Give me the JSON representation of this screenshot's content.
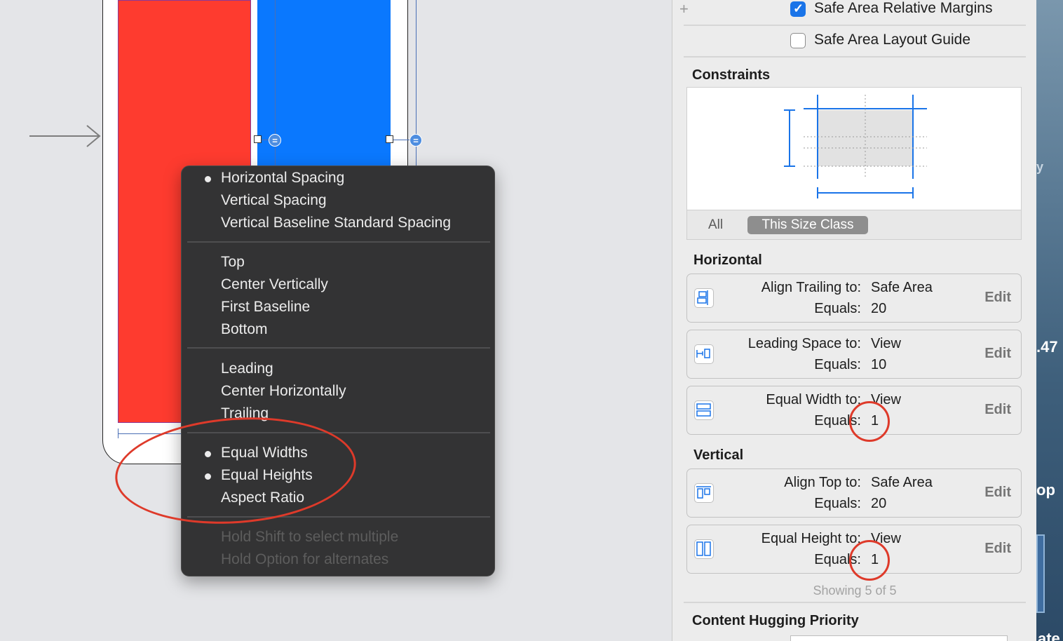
{
  "menu": {
    "items": [
      {
        "label": "Horizontal Spacing",
        "checked": true
      },
      {
        "label": "Vertical Spacing",
        "checked": false
      },
      {
        "label": "Vertical Baseline Standard Spacing",
        "checked": false
      },
      {
        "label": "Top",
        "checked": false
      },
      {
        "label": "Center Vertically",
        "checked": false
      },
      {
        "label": "First Baseline",
        "checked": false
      },
      {
        "label": "Bottom",
        "checked": false
      },
      {
        "label": "Leading",
        "checked": false
      },
      {
        "label": "Center Horizontally",
        "checked": false
      },
      {
        "label": "Trailing",
        "checked": false
      },
      {
        "label": "Equal Widths",
        "checked": true
      },
      {
        "label": "Equal Heights",
        "checked": true
      },
      {
        "label": "Aspect Ratio",
        "checked": false
      }
    ],
    "hints": [
      "Hold Shift to select multiple",
      "Hold Option for alternates"
    ]
  },
  "canvas": {
    "eq_symbol": "="
  },
  "inspector": {
    "plus": "+",
    "safe_area_relative_margins": {
      "label": "Safe Area Relative Margins",
      "checked": true
    },
    "safe_area_layout_guide": {
      "label": "Safe Area Layout Guide",
      "checked": false
    },
    "constraints_title": "Constraints",
    "tabs": {
      "all": "All",
      "this_size_class": "This Size Class"
    },
    "horizontal_title": "Horizontal",
    "horizontal": [
      {
        "icon": "align-trailing-icon",
        "label1": "Align Trailing to:",
        "value1": "Safe Area",
        "label2": "Equals:",
        "value2": "20",
        "edit": "Edit"
      },
      {
        "icon": "leading-space-icon",
        "label1": "Leading Space to:",
        "value1": "View",
        "label2": "Equals:",
        "value2": "10",
        "edit": "Edit"
      },
      {
        "icon": "equal-width-icon",
        "label1": "Equal Width to:",
        "value1": "View",
        "label2": "Equals:",
        "value2": "1",
        "edit": "Edit"
      }
    ],
    "vertical_title": "Vertical",
    "vertical": [
      {
        "icon": "align-top-icon",
        "label1": "Align Top to:",
        "value1": "Safe Area",
        "label2": "Equals:",
        "value2": "20",
        "edit": "Edit"
      },
      {
        "icon": "equal-height-icon",
        "label1": "Equal Height to:",
        "value1": "View",
        "label2": "Equals:",
        "value2": "1",
        "edit": "Edit"
      }
    ],
    "showing": "Showing 5 of 5",
    "content_hugging_title": "Content Hugging Priority"
  },
  "desktop": {
    "fragments": [
      "y",
      ".47",
      "op",
      "ate"
    ]
  },
  "colors": {
    "red_view": "#fe3b2f",
    "blue_view": "#0a78fe",
    "annotation": "#de3a2a",
    "checkbox_accent": "#1a74e8"
  }
}
